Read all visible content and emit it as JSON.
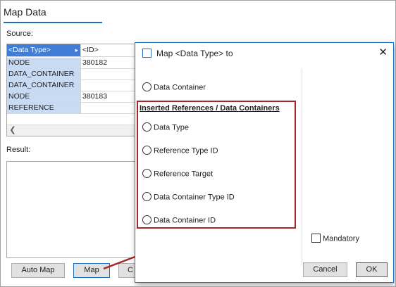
{
  "panel": {
    "title": "Map Data",
    "source_label": "Source:",
    "result_label": "Result:"
  },
  "source_grid": {
    "columns": [
      "<Data Type>",
      "<ID>"
    ],
    "rows": [
      [
        "NODE",
        "380182"
      ],
      [
        "DATA_CONTAINER",
        ""
      ],
      [
        "DATA_CONTAINER",
        ""
      ],
      [
        "NODE",
        "380183"
      ],
      [
        "REFERENCE",
        ""
      ]
    ]
  },
  "buttons": {
    "auto_map": "Auto Map",
    "map": "Map",
    "partial": "C"
  },
  "dialog": {
    "title": "Map <Data Type> to",
    "close_symbol": "✕",
    "option_data_container": "Data Container",
    "group_heading": "Inserted References / Data Containers",
    "options": [
      "Data Type",
      "Reference Type ID",
      "Reference Target",
      "Data Container Type ID",
      "Data Container ID"
    ],
    "mandatory_label": "Mandatory",
    "cancel_label": "Cancel",
    "ok_label": "OK"
  },
  "colors": {
    "accent": "#1f6fbf",
    "highlight_border": "#a5262a",
    "selected_header": "#3f7dd6",
    "row_header_bg": "#c9daf3"
  }
}
